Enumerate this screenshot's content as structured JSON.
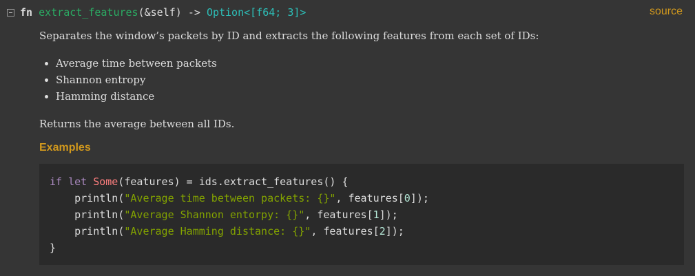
{
  "signature": {
    "keyword": "fn",
    "name": "extract_features",
    "params": "(&self) -> ",
    "return_type": "Option<[f64; 3]>"
  },
  "source_link": "source",
  "doc": {
    "intro": "Separates the window’s packets by ID and extracts the following features from each set of IDs:",
    "features": [
      "Average time between packets",
      "Shannon entropy",
      "Hamming distance"
    ],
    "returns": "Returns the average between all IDs."
  },
  "examples_heading": "Examples",
  "code": {
    "line1": {
      "kw1": "if",
      "kw2": "let",
      "enum": "Some",
      "rest": "(features) = ids.extract_features() {"
    },
    "line2": {
      "call": "println(",
      "str": "\"Average time between packets: {}\"",
      "mid": ", features[",
      "idx": "0",
      "end": "]);"
    },
    "line3": {
      "call": "println(",
      "str": "\"Average Shannon entorpy: {}\"",
      "mid": ", features[",
      "idx": "1",
      "end": "]);"
    },
    "line4": {
      "call": "println(",
      "str": "\"Average Hamming distance: {}\"",
      "mid": ", features[",
      "idx": "2",
      "end": "]);"
    },
    "line5": "}"
  },
  "colors": {
    "background": "#353535",
    "code_background": "#2a2a2a",
    "function_name": "#2bab63",
    "type": "#2dbfb8",
    "accent": "#d2991d",
    "keyword": "#ab8ac1",
    "enum": "#ff7f7f",
    "string": "#83a300",
    "number": "#b4e7d6"
  }
}
